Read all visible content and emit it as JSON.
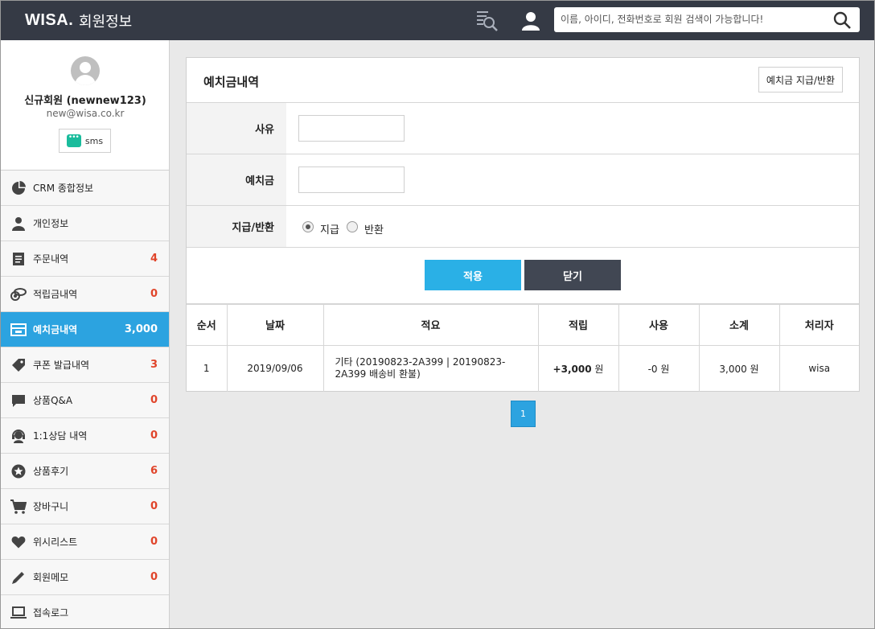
{
  "header": {
    "brand": "WISA.",
    "title": "회원정보",
    "search_placeholder": "이름, 아이디, 전화번호로 회원 검색이 가능합니다!"
  },
  "profile": {
    "name": "신규회원 (newnew123)",
    "email": "new@wisa.co.kr",
    "sms_label": "sms"
  },
  "sidebar": {
    "items": [
      {
        "label": "CRM 종합정보",
        "count": "",
        "icon": "pie-chart-icon"
      },
      {
        "label": "개인정보",
        "count": "",
        "icon": "person-icon"
      },
      {
        "label": "주문내역",
        "count": "4",
        "icon": "document-icon"
      },
      {
        "label": "적립금내역",
        "count": "0",
        "icon": "coins-icon"
      },
      {
        "label": "예치금내역",
        "count": "3,000",
        "icon": "deposit-icon"
      },
      {
        "label": "쿠폰 발급내역",
        "count": "3",
        "icon": "tag-icon"
      },
      {
        "label": "상품Q&A",
        "count": "0",
        "icon": "chat-icon"
      },
      {
        "label": "1:1상담 내역",
        "count": "0",
        "icon": "headset-icon"
      },
      {
        "label": "상품후기",
        "count": "6",
        "icon": "star-icon"
      },
      {
        "label": "장바구니",
        "count": "0",
        "icon": "cart-icon"
      },
      {
        "label": "위시리스트",
        "count": "0",
        "icon": "heart-icon"
      },
      {
        "label": "회원메모",
        "count": "0",
        "icon": "pencil-icon"
      },
      {
        "label": "접속로그",
        "count": "",
        "icon": "laptop-icon"
      }
    ]
  },
  "panel": {
    "title": "예치금내역",
    "action_button": "예치금 지급/반환",
    "form": {
      "reason_label": "사유",
      "reason_value": "",
      "amount_label": "예치금",
      "amount_value": "",
      "type_label": "지급/반환",
      "type_options": [
        "지급",
        "반환"
      ],
      "type_selected": "지급"
    },
    "apply_label": "적용",
    "close_label": "닫기"
  },
  "table": {
    "headers": [
      "순서",
      "날짜",
      "적요",
      "적립",
      "사용",
      "소계",
      "처리자"
    ],
    "rows": [
      {
        "no": "1",
        "date": "2019/09/06",
        "memo": "기타 (20190823-2A399 | 20190823-2A399 배송비 환불)",
        "earn": "+3,000",
        "earn_unit": "원",
        "use": "-0 원",
        "subtotal": "3,000 원",
        "handler": "wisa"
      }
    ]
  },
  "pagination": {
    "current": "1"
  },
  "colors": {
    "header_bg": "#353a45",
    "accent": "#2ca3e0",
    "count": "#e0442a",
    "close_btn": "#414753"
  }
}
